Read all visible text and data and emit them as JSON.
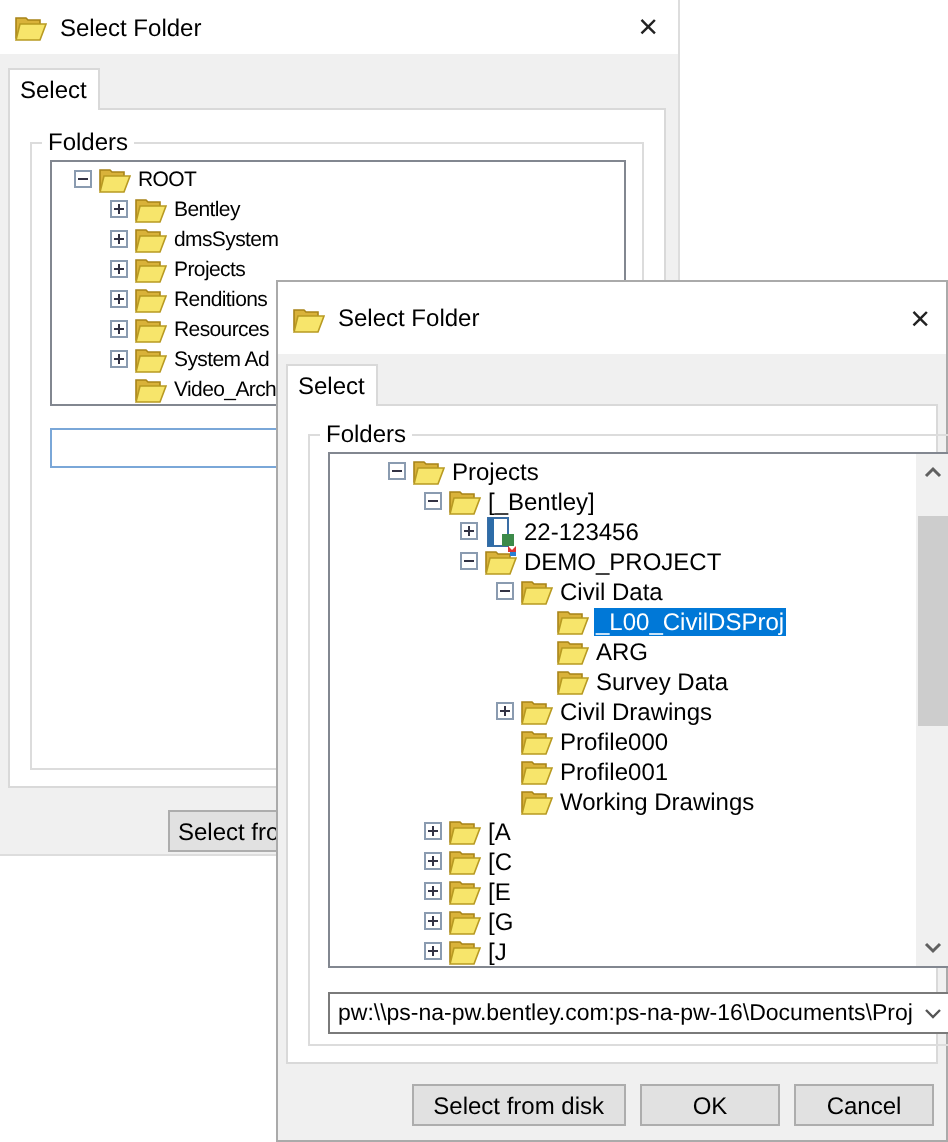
{
  "dialogs": [
    {
      "title": "Select Folder",
      "close": "×",
      "tabs": [
        {
          "label": "Select",
          "selected": true
        }
      ],
      "group_label": "Folders",
      "tree": {
        "items": [
          {
            "label": "ROOT",
            "kind": "folder",
            "expandable": true,
            "expanded": true,
            "selected": false,
            "children": [
              {
                "label": "Bentley",
                "kind": "folder",
                "expandable": true,
                "expanded": false,
                "selected": false
              },
              {
                "label": "dmsSystem",
                "kind": "folder",
                "expandable": true,
                "expanded": false,
                "selected": false
              },
              {
                "label": "Projects",
                "kind": "folder",
                "expandable": true,
                "expanded": false,
                "selected": false
              },
              {
                "label": "Renditions",
                "kind": "folder",
                "expandable": true,
                "expanded": false,
                "selected": false
              },
              {
                "label": "Resources",
                "kind": "folder",
                "expandable": true,
                "expanded": false,
                "selected": false
              },
              {
                "label": "System Ad",
                "kind": "folder",
                "expandable": true,
                "expanded": false,
                "selected": false
              },
              {
                "label": "Video_Arch",
                "kind": "folder",
                "expandable": false,
                "selected": false
              }
            ]
          }
        ]
      },
      "path_field": {
        "kind": "input"
      },
      "buttons": [
        "Select fro"
      ]
    },
    {
      "title": "Select Folder",
      "close": "×",
      "tabs": [
        {
          "label": "Select",
          "selected": true
        }
      ],
      "group_label": "Folders",
      "tree": {
        "scrollbar": true,
        "items": [
          {
            "label": "Projects",
            "kind": "folder",
            "expandable": true,
            "expanded": true,
            "selected": false,
            "children": [
              {
                "label": "[_Bentley]",
                "kind": "folder",
                "expandable": true,
                "expanded": true,
                "selected": false,
                "children": [
                  {
                    "label": "22-123456",
                    "kind": "project",
                    "expandable": true,
                    "expanded": false,
                    "selected": false
                  },
                  {
                    "label": "DEMO_PROJECT",
                    "kind": "project-folder",
                    "expandable": true,
                    "expanded": true,
                    "selected": false,
                    "children": [
                      {
                        "label": "Civil Data",
                        "kind": "folder",
                        "expandable": true,
                        "expanded": true,
                        "selected": false,
                        "children": [
                          {
                            "label": "_L00_CivilDSProj",
                            "kind": "folder",
                            "expandable": false,
                            "selected": true
                          },
                          {
                            "label": "ARG",
                            "kind": "folder",
                            "expandable": false,
                            "selected": false
                          },
                          {
                            "label": "Survey Data",
                            "kind": "folder",
                            "expandable": false,
                            "selected": false
                          }
                        ]
                      },
                      {
                        "label": "Civil Drawings",
                        "kind": "folder",
                        "expandable": true,
                        "expanded": false,
                        "selected": false
                      },
                      {
                        "label": "Profile000",
                        "kind": "folder",
                        "expandable": false,
                        "selected": false
                      },
                      {
                        "label": "Profile001",
                        "kind": "folder",
                        "expandable": false,
                        "selected": false
                      },
                      {
                        "label": "Working Drawings",
                        "kind": "folder",
                        "expandable": false,
                        "selected": false
                      }
                    ]
                  }
                ]
              },
              {
                "label": "[A",
                "kind": "folder",
                "expandable": true,
                "expanded": false,
                "selected": false
              },
              {
                "label": "[C",
                "kind": "folder",
                "expandable": true,
                "expanded": false,
                "selected": false
              },
              {
                "label": "[E",
                "kind": "folder",
                "expandable": true,
                "expanded": false,
                "selected": false
              },
              {
                "label": "[G",
                "kind": "folder",
                "expandable": true,
                "expanded": false,
                "selected": false
              },
              {
                "label": "[J",
                "kind": "folder",
                "expandable": true,
                "expanded": false,
                "selected": false
              }
            ]
          }
        ]
      },
      "path_field": {
        "kind": "combo",
        "value": "pw:\\\\ps-na-pw.bentley.com:ps-na-pw-16\\Documents\\Proj"
      },
      "buttons": [
        "Select from disk",
        "OK",
        "Cancel"
      ]
    }
  ]
}
